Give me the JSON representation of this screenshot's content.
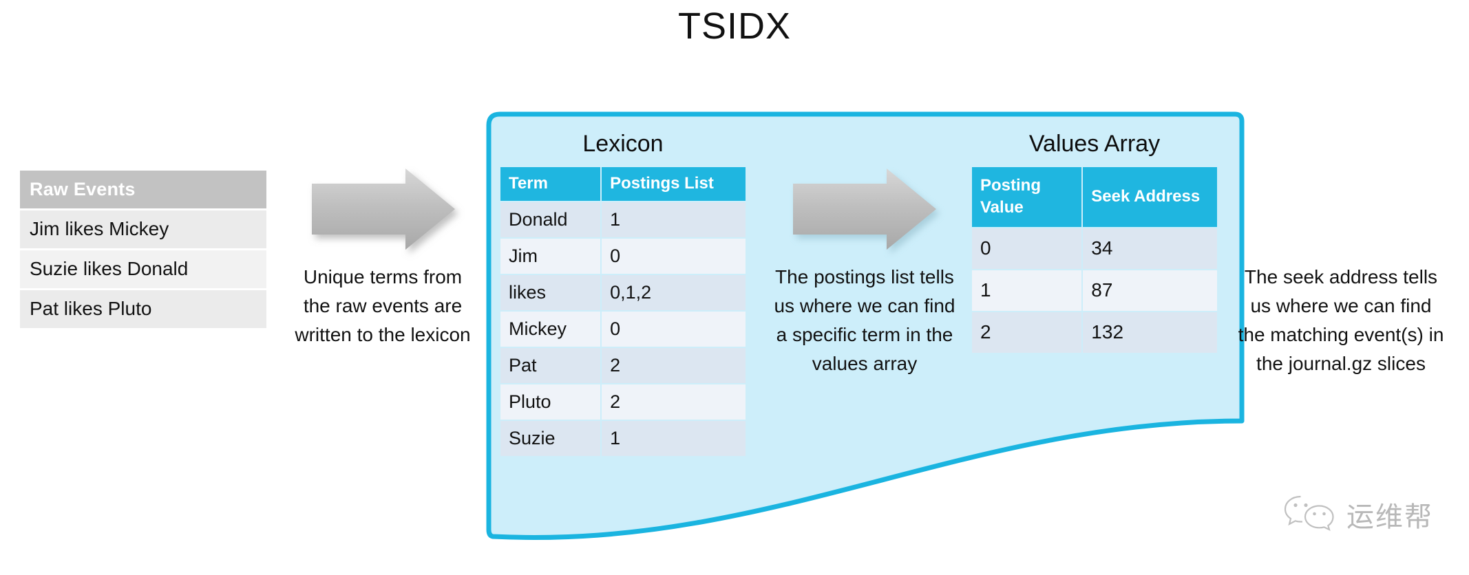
{
  "title": "TSIDX",
  "raw_events": {
    "header": "Raw Events",
    "rows": [
      "Jim likes Mickey",
      "Suzie likes Donald",
      "Pat likes Pluto"
    ]
  },
  "captions": {
    "left": "Unique terms from the raw events are written to the lexicon",
    "middle": "The postings list tells us where we can find a specific term in the values array",
    "right": "The seek address tells us where we can find the matching event(s) in the journal.gz slices"
  },
  "lexicon": {
    "title": "Lexicon",
    "columns": [
      "Term",
      "Postings List"
    ],
    "rows": [
      [
        "Donald",
        "1"
      ],
      [
        "Jim",
        "0"
      ],
      [
        "likes",
        "0,1,2"
      ],
      [
        "Mickey",
        "0"
      ],
      [
        "Pat",
        "2"
      ],
      [
        "Pluto",
        "2"
      ],
      [
        "Suzie",
        "1"
      ]
    ]
  },
  "values_array": {
    "title": "Values Array",
    "columns": [
      "Posting Value",
      "Seek Address"
    ],
    "rows": [
      [
        "0",
        "34"
      ],
      [
        "1",
        "87"
      ],
      [
        "2",
        "132"
      ]
    ]
  },
  "watermark": {
    "text": "运维帮",
    "icon": "wechat-icon"
  },
  "colors": {
    "accent_blue": "#1fb6e0",
    "panel_fill": "#cdeefa",
    "panel_border": "#1ab4e0",
    "raw_header_gray": "#c2c2c2",
    "row_dark": "#dce6f1",
    "row_light": "#eff3f9",
    "arrow_gray": "#b3b3b3"
  }
}
